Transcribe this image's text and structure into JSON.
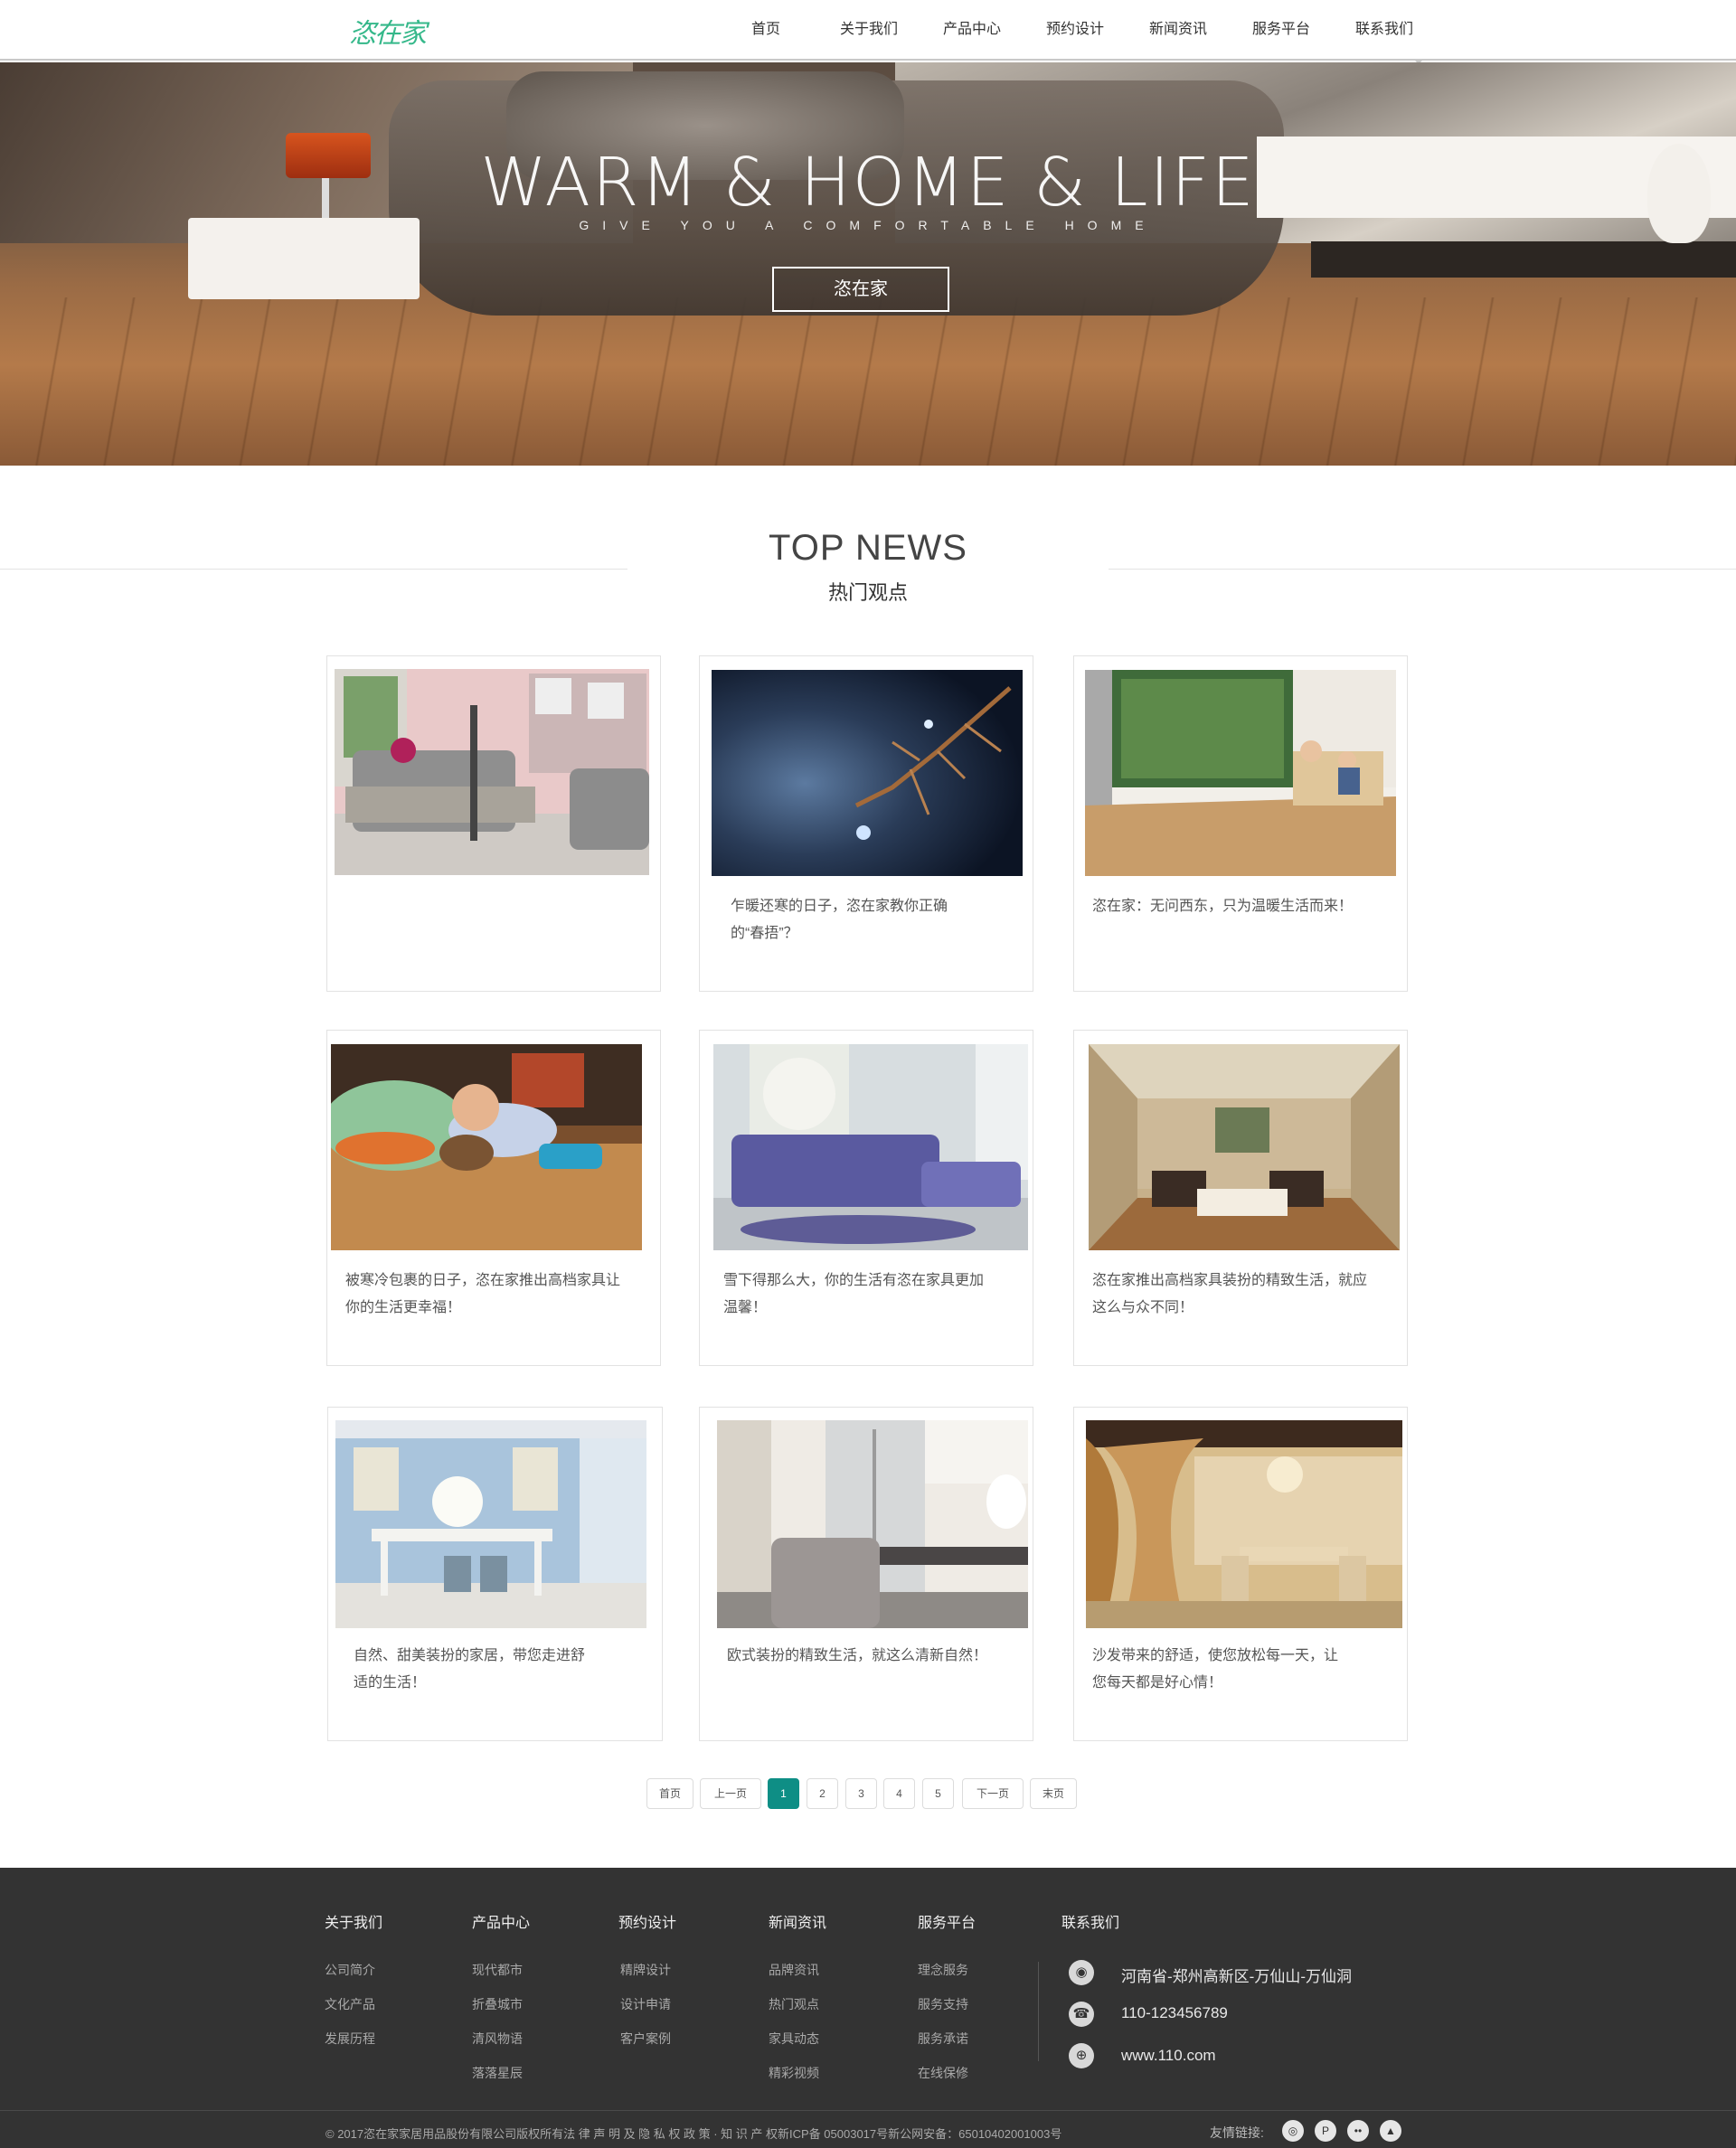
{
  "header": {
    "logo": "恣在家",
    "nav": [
      "首页",
      "关于我们",
      "产品中心",
      "预约设计",
      "新闻资讯",
      "服务平台",
      "联系我们"
    ]
  },
  "banner": {
    "title": "WARM & HOME & LIFE",
    "subtitle": "GIVE YOU A COMFORTABLE HOME",
    "button": "恣在家"
  },
  "section": {
    "title": "TOP NEWS",
    "subtitle": "热门观点"
  },
  "cards": [
    {
      "text_line1": "",
      "text_line2": "",
      "image": "living-room-sofa"
    },
    {
      "text_line1": "乍暖还寒的日子，恣在家教你正确",
      "text_line2": "的“春捂”？",
      "image": "frosty-branch"
    },
    {
      "text_line1": "恣在家：无问西东，只为温暖生活而来！",
      "text_line2": "",
      "image": "family-room"
    },
    {
      "text_line1": "被寒冷包裹的日子，恣在家推出高档家具让",
      "text_line2": "你的生活更幸福！",
      "image": "child-on-floor"
    },
    {
      "text_line1": "雪下得那么大，你的生活有恣在家具更加",
      "text_line2": "温馨！",
      "image": "purple-sofa"
    },
    {
      "text_line1": "恣在家推出高档家具装扮的精致生活，就应",
      "text_line2": "这么与众不同！",
      "image": "grand-living-room"
    },
    {
      "text_line1": "自然、甜美装扮的家居，带您走进舒",
      "text_line2": "适的生活！",
      "image": "blue-dining-room"
    },
    {
      "text_line1": "欧式装扮的精致生活，就这么清新自然！",
      "text_line2": "",
      "image": "kitchen-dining"
    },
    {
      "text_line1": "沙发带来的舒适，使您放松每一天，让",
      "text_line2": "您每天都是好心情！",
      "image": "european-dining"
    }
  ],
  "pager": {
    "first": "首页",
    "prev": "上一页",
    "pages": [
      "1",
      "2",
      "3",
      "4",
      "5"
    ],
    "next": "下一页",
    "last": "末页",
    "active": "1"
  },
  "footer": {
    "columns": [
      {
        "title": "关于我们",
        "links": [
          "公司简介",
          "文化产品",
          "发展历程"
        ]
      },
      {
        "title": "产品中心",
        "links": [
          "现代都市",
          "折叠城市",
          "清风物语",
          "落落星辰"
        ]
      },
      {
        "title": "预约设计",
        "links": [
          "精牌设计",
          "设计申请",
          "客户案例"
        ]
      },
      {
        "title": "新闻资讯",
        "links": [
          "品牌资讯",
          "热门观点",
          "家具动态",
          "精彩视频"
        ]
      },
      {
        "title": "服务平台",
        "links": [
          "理念服务",
          "服务支持",
          "服务承诺",
          "在线保修"
        ]
      }
    ],
    "contact_title": "联系我们",
    "address": "河南省-郑州高新区-万仙山-万仙洞",
    "phone": "110-123456789",
    "website": "www.110.com",
    "copyright": "© 2017恣在家家居用品股份有限公司版权所有法 律 声 明 及 隐 私 权 政 策 · 知 识 产 权新ICP备 05003017号新公网安备：65010402001003号",
    "friend_links": "友情链接:"
  },
  "colors": {
    "brand_green": "#35b88a",
    "pager_active": "#0e8e85",
    "footer_bg": "#333333"
  }
}
